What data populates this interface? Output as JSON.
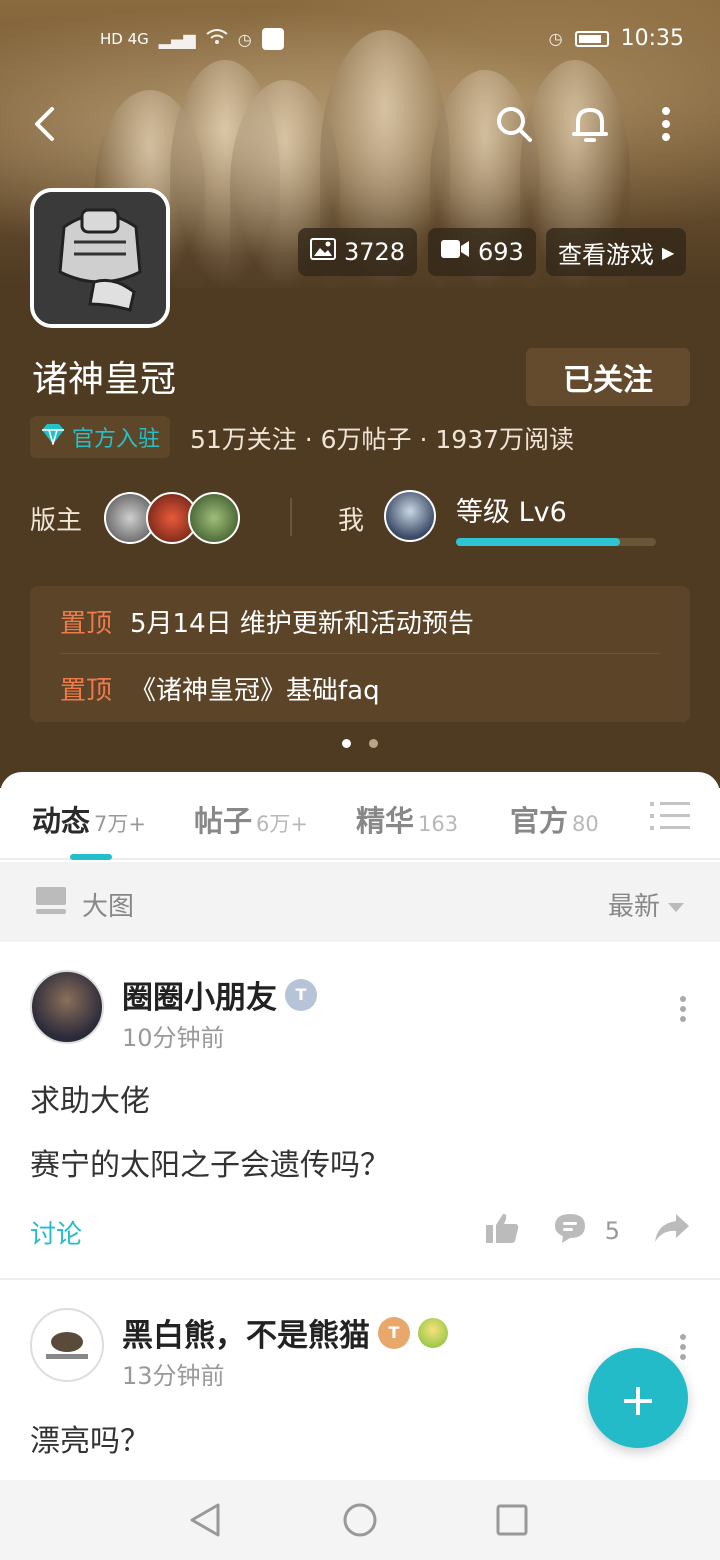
{
  "status_bar": {
    "network_label": "HD 4G",
    "time": "10:35"
  },
  "banner": {
    "images_count": "3728",
    "videos_count": "693",
    "view_game_label": "查看游戏"
  },
  "game": {
    "title": "诸神皇冠",
    "follow_label": "已关注",
    "official_label": "官方入驻",
    "stats": "51万关注 · 6万帖子 · 1937万阅读"
  },
  "community": {
    "moderator_label": "版主",
    "me_label": "我",
    "level_text": "等级 Lv6",
    "level_progress": 0.82
  },
  "pinned": [
    {
      "tag": "置顶",
      "text": "5月14日 维护更新和活动预告"
    },
    {
      "tag": "置顶",
      "text": "《诸神皇冠》基础faq"
    }
  ],
  "tabs": [
    {
      "label": "动态",
      "count": "7万+"
    },
    {
      "label": "帖子",
      "count": "6万+"
    },
    {
      "label": "精华",
      "count": "163"
    },
    {
      "label": "官方",
      "count": "80"
    }
  ],
  "filter": {
    "view_label": "大图",
    "sort_label": "最新"
  },
  "posts": [
    {
      "author": "圈圈小朋友",
      "badge": "T",
      "time": "10分钟前",
      "lines": [
        "求助大佬",
        "赛宁的太阳之子会遗传吗？"
      ],
      "tag": "讨论",
      "comments": "5"
    },
    {
      "author": "黑白熊，不是熊猫",
      "badge": "T",
      "time": "13分钟前",
      "lines": [
        "漂亮吗？"
      ]
    }
  ],
  "colors": {
    "accent": "#23bec9",
    "header_bg": "#4f3a22",
    "pin_tag": "#ef7a4a"
  }
}
